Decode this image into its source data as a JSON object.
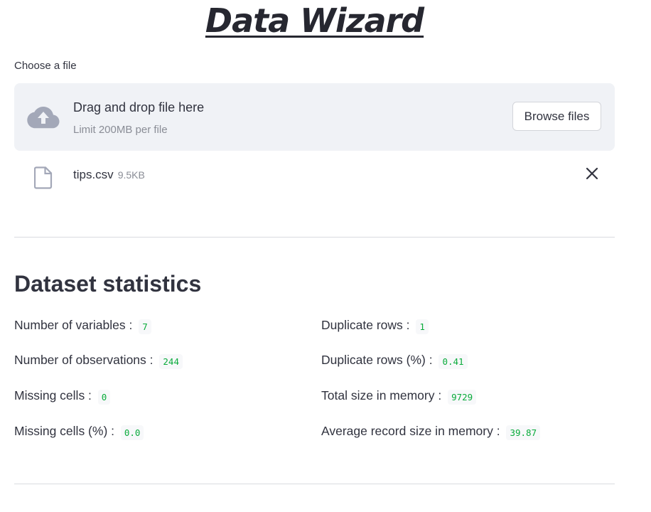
{
  "app": {
    "title": "Data Wizard"
  },
  "uploader": {
    "label": "Choose a file",
    "drop_text": "Drag and drop file here",
    "limit_text": "Limit 200MB per file",
    "browse_label": "Browse files",
    "upload_icon": "cloud-upload-icon"
  },
  "uploaded_file": {
    "name": "tips.csv",
    "size": "9.5KB",
    "file_icon": "file-icon",
    "remove_icon": "close-icon"
  },
  "stats": {
    "heading": "Dataset statistics",
    "left": [
      {
        "label": "Number of variables :",
        "value": "7"
      },
      {
        "label": "Number of observations :",
        "value": "244"
      },
      {
        "label": "Missing cells :",
        "value": "0"
      },
      {
        "label": "Missing cells (%) :",
        "value": "0.0"
      }
    ],
    "right": [
      {
        "label": "Duplicate rows :",
        "value": "1"
      },
      {
        "label": "Duplicate rows (%) :",
        "value": "0.41"
      },
      {
        "label": "Total size in memory :",
        "value": "9729"
      },
      {
        "label": "Average record size in memory :",
        "value": "39.87"
      }
    ]
  },
  "colors": {
    "value_green": "#09ab3b",
    "dropzone_bg": "#f0f2f6",
    "text": "#31333f"
  }
}
